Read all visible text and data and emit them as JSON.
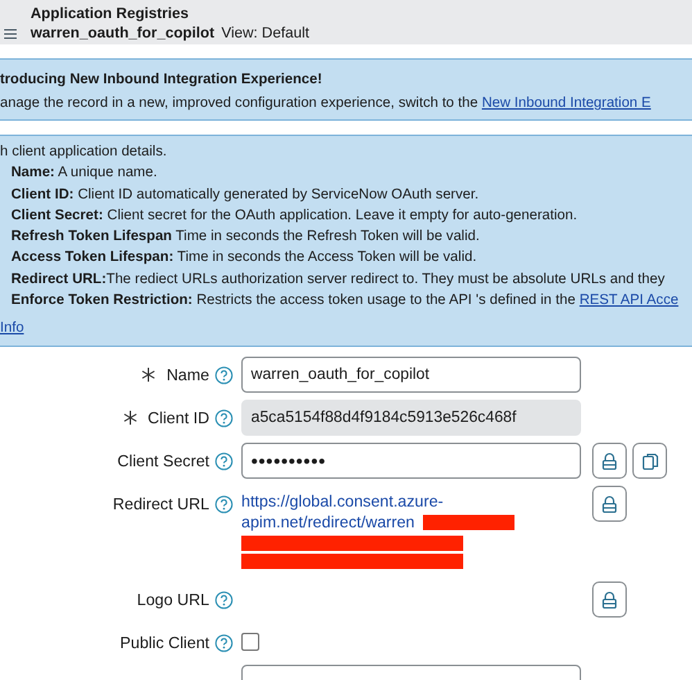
{
  "header": {
    "title": "Application Registries",
    "record_name": "warren_oauth_for_copilot",
    "view_label": "View: Default"
  },
  "notice": {
    "title": "troducing New Inbound Integration Experience!",
    "message": "anage the record in a new, improved configuration experience, switch to the",
    "link": "New Inbound Integration E"
  },
  "info": {
    "intro": "h client application details.",
    "items": [
      {
        "text": "**Name:** A unique name."
      },
      {
        "text": "**Client ID:** Client ID automatically generated by ServiceNow OAuth server."
      },
      {
        "text": "**Client Secret:** Client secret for the OAuth application. Leave it empty for auto-generation."
      },
      {
        "text": "**Refresh Token Lifespan** Time in seconds the Refresh Token will be valid."
      },
      {
        "text": "**Access Token Lifespan:** Time in seconds the Access Token will be valid."
      },
      {
        "text": "**Redirect URL:**The rediect URLs authorization server redirect to. They must be absolute URLs and they"
      },
      {
        "text": "**Enforce Token Restriction:** Restricts the access token usage to the API 's defined in the",
        "link": "REST API Acce"
      }
    ],
    "more_link": "Info"
  },
  "form": [
    {
      "kind": "text",
      "label": "Name",
      "required": true,
      "value": "warren_oauth_for_copilot"
    },
    {
      "kind": "readonly",
      "label": "Client ID",
      "required": true,
      "value": "a5ca5154f88d4f9184c5913e526c468f"
    },
    {
      "kind": "password",
      "label": "Client Secret",
      "required": false,
      "value": "••••••••••",
      "actions": [
        {
          "kind": "lock"
        },
        {
          "kind": "copy"
        }
      ]
    },
    {
      "kind": "link",
      "label": "Redirect URL",
      "required": false,
      "value": "https://global.consent.azure-apim.net/redirect/warren",
      "actions": [
        {
          "kind": "lock"
        }
      ]
    },
    {
      "kind": "empty",
      "label": "Logo URL",
      "required": false,
      "actions": [
        {
          "kind": "lock"
        }
      ]
    },
    {
      "kind": "checkbox",
      "label": "Public Client",
      "required": false,
      "checked": false
    },
    {
      "kind": "cut"
    }
  ]
}
